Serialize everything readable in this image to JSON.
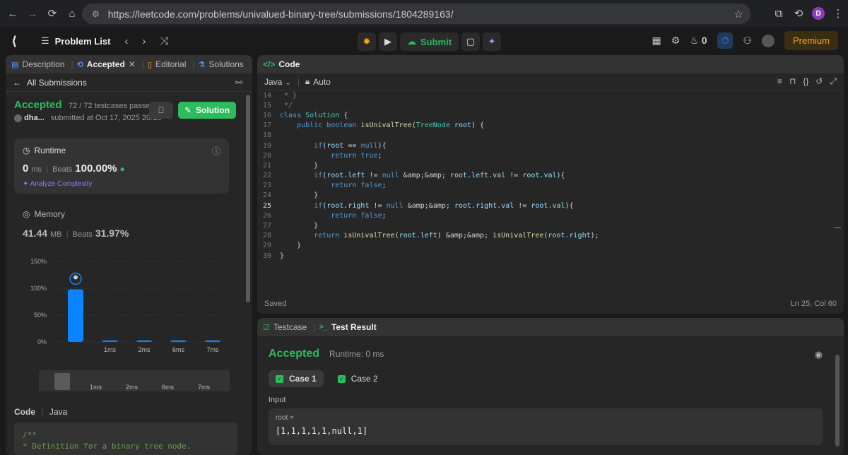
{
  "browser": {
    "url": "https://leetcode.com/problems/univalued-binary-tree/submissions/1804289163/",
    "profile_letter": "D"
  },
  "topbar": {
    "problem_list": "Problem List",
    "submit": "Submit",
    "streak": "0",
    "premium": "Premium"
  },
  "left_tabs": {
    "description": "Description",
    "accepted": "Accepted",
    "editorial": "Editorial",
    "solutions": "Solutions"
  },
  "submissions": {
    "back_label": "All Submissions",
    "status": "Accepted",
    "passed": "72 / 72 testcases passed",
    "user": "dha...",
    "submitted": "submitted at Oct 17, 2025 20:16",
    "solution_btn": "Solution"
  },
  "runtime": {
    "label": "Runtime",
    "value": "0",
    "unit": "ms",
    "beats_label": "Beats",
    "beats": "100.00%",
    "analyze": "Analyze Complexity"
  },
  "memory": {
    "label": "Memory",
    "value": "41.44",
    "unit": "MB",
    "beats_label": "Beats",
    "beats": "31.97%"
  },
  "chart_data": {
    "type": "bar",
    "categories": [
      "0ms",
      "1ms",
      "2ms",
      "6ms",
      "7ms"
    ],
    "tick_labels": [
      "",
      "1ms",
      "2ms",
      "6ms",
      "7ms"
    ],
    "values": [
      98,
      3,
      3,
      3,
      3
    ],
    "yticks": [
      "150%",
      "100%",
      "50%",
      "0%"
    ],
    "ylim": [
      0,
      150
    ],
    "mini_labels": [
      "1ms",
      "2ms",
      "6ms",
      "7ms"
    ],
    "color": "#0a84ff"
  },
  "code_section": {
    "label": "Code",
    "lang": "Java",
    "snippet": [
      "/**",
      " * Definition for a binary tree node."
    ]
  },
  "editor": {
    "title": "Code",
    "lang": "Java",
    "mode": "Auto",
    "saved": "Saved",
    "position": "Ln 25, Col 60",
    "lines": [
      {
        "n": "14",
        "t": " * }"
      },
      {
        "n": "15",
        "t": " */"
      },
      {
        "n": "16",
        "t": "class Solution {"
      },
      {
        "n": "17",
        "t": "    public boolean isUnivalTree(TreeNode root) {"
      },
      {
        "n": "18",
        "t": ""
      },
      {
        "n": "19",
        "t": "        if(root == null){"
      },
      {
        "n": "20",
        "t": "            return true;"
      },
      {
        "n": "21",
        "t": "        }"
      },
      {
        "n": "22",
        "t": "        if(root.left != null && root.left.val != root.val){"
      },
      {
        "n": "23",
        "t": "            return false;"
      },
      {
        "n": "24",
        "t": "        }"
      },
      {
        "n": "25",
        "t": "        if(root.right != null && root.right.val != root.val){"
      },
      {
        "n": "26",
        "t": "            return false;"
      },
      {
        "n": "27",
        "t": "        }"
      },
      {
        "n": "28",
        "t": "        return isUnivalTree(root.left) && isUnivalTree(root.right);"
      },
      {
        "n": "29",
        "t": "    }"
      },
      {
        "n": "30",
        "t": "}"
      }
    ]
  },
  "test": {
    "tab_testcase": "Testcase",
    "tab_result": "Test Result",
    "status": "Accepted",
    "runtime": "Runtime: 0 ms",
    "case1": "Case 1",
    "case2": "Case 2",
    "input_label": "Input",
    "var_label": "root =",
    "var_value": "[1,1,1,1,1,null,1]"
  }
}
